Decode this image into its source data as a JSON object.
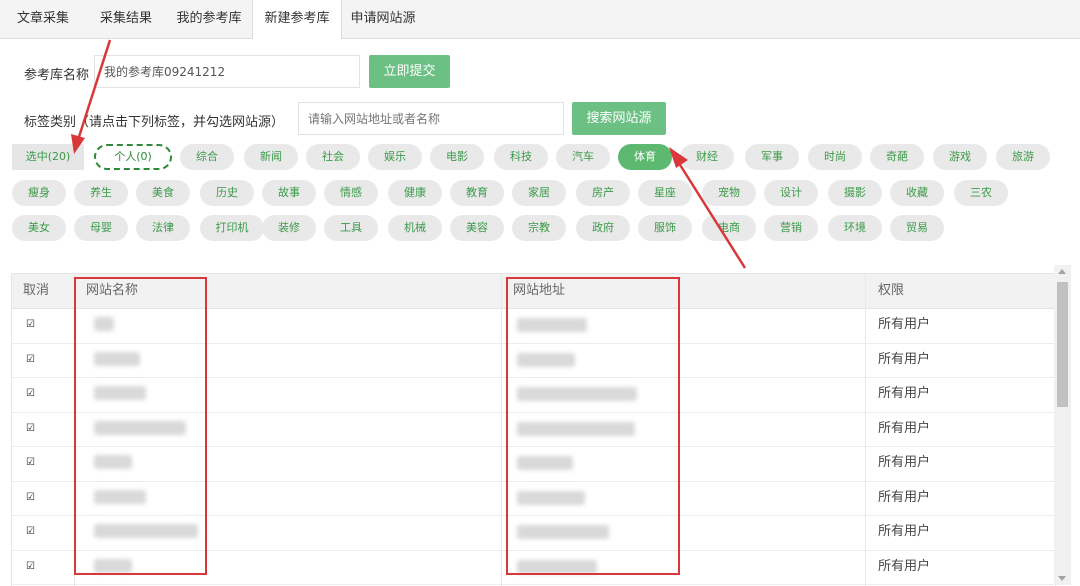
{
  "tabs": [
    {
      "label": "文章采集"
    },
    {
      "label": "采集结果"
    },
    {
      "label": "我的参考库"
    },
    {
      "label": "新建参考库",
      "active": true
    },
    {
      "label": "申请网站源"
    }
  ],
  "form": {
    "name_label": "参考库名称",
    "name_value": "我的参考库09241212",
    "submit_label": "立即提交",
    "tag_label": "标签类别（请点击下列标签，并勾选网站源）",
    "search_placeholder": "请输入网站地址或者名称",
    "search_button": "搜索网站源"
  },
  "tags": {
    "selected_count": "选中(20)",
    "personal": "个人(0)",
    "active": "体育",
    "row1": [
      "综合",
      "新闻",
      "社会",
      "娱乐",
      "电影",
      "科技",
      "汽车",
      "体育",
      "财经",
      "军事",
      "时尚",
      "奇葩",
      "游戏",
      "旅游"
    ],
    "row2": [
      "瘦身",
      "养生",
      "美食",
      "历史",
      "故事",
      "情感",
      "健康",
      "教育",
      "家居",
      "房产",
      "星座",
      "宠物",
      "设计",
      "摄影",
      "收藏",
      "三农"
    ],
    "row3": [
      "美女",
      "母婴",
      "法律",
      "打印机",
      "装修",
      "工具",
      "机械",
      "美容",
      "宗教",
      "政府",
      "服饰",
      "电商",
      "营销",
      "环境",
      "贸易"
    ]
  },
  "table": {
    "headers": {
      "cancel": "取消",
      "site_name": "网站名称",
      "site_url": "网站地址",
      "permission": "权限"
    },
    "rows": [
      {
        "checked": true,
        "permission": "所有用户"
      },
      {
        "checked": true,
        "permission": "所有用户"
      },
      {
        "checked": true,
        "permission": "所有用户"
      },
      {
        "checked": true,
        "permission": "所有用户"
      },
      {
        "checked": true,
        "permission": "所有用户"
      },
      {
        "checked": true,
        "permission": "所有用户"
      },
      {
        "checked": true,
        "permission": "所有用户"
      },
      {
        "checked": true,
        "permission": "所有用户"
      }
    ]
  },
  "colors": {
    "accent_green": "#6cc084",
    "tag_text_green": "#3c9a4a",
    "annotation_red": "#d9383a"
  }
}
